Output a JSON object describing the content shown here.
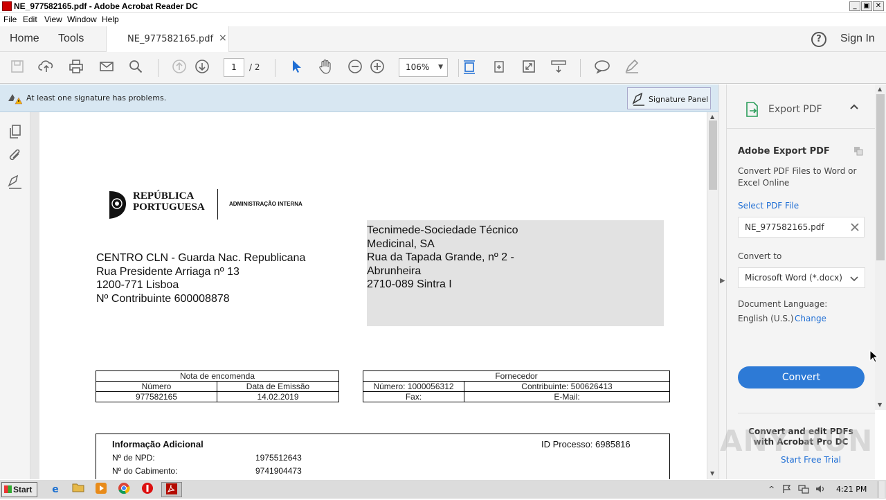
{
  "window": {
    "title": "NE_977582165.pdf - Adobe Acrobat Reader DC",
    "controls": [
      "_",
      "▣",
      "✕"
    ]
  },
  "menu": [
    "File",
    "Edit",
    "View",
    "Window",
    "Help"
  ],
  "tabs": {
    "home": "Home",
    "tools": "Tools",
    "doc": "NE_977582165.pdf",
    "doc_close": "×",
    "sign_in": "Sign In",
    "help": "?"
  },
  "toolbar": {
    "page_current": "1",
    "page_total": "/ 2",
    "zoom": "106%",
    "zoom_caret": "▼"
  },
  "sigbar": {
    "message": "At least one signature has problems.",
    "panel_button": "Signature Panel"
  },
  "doc": {
    "logo_line1": "REPÚBLICA",
    "logo_line2": "PORTUGUESA",
    "logo_dept": "ADMINISTRAÇÃO INTERNA",
    "sender": [
      "CENTRO CLN - Guarda Nac. Republicana",
      "Rua Presidente Arriaga nº 13",
      "1200-771 Lisboa",
      "Nº Contribuinte 600008878"
    ],
    "recipient": [
      "Tecnimede-Sociedade Técnico",
      "Medicinal, SA",
      "Rua da Tapada Grande, nº 2 -",
      "Abrunheira",
      "2710-089 Sintra I"
    ],
    "order_table": {
      "title": "Nota de encomenda",
      "h1": "Número",
      "h2": "Data de Emissão",
      "v1": "977582165",
      "v2": "14.02.2019"
    },
    "supplier_table": {
      "title": "Fornecedor",
      "c1": "Número: 1000056312",
      "c2": "Contribuinte: 500626413",
      "c3": "Fax:",
      "c4": "E-Mail:"
    },
    "info": {
      "title": "Informação Adicional",
      "process": "ID Processo: 6985816",
      "npd_label": "Nº de NPD:",
      "npd_value": "1975512643",
      "cab_label": "Nº do Cabimento:",
      "cab_value": "9741904473"
    }
  },
  "panel": {
    "header": "Export PDF",
    "section_title": "Adobe Export PDF",
    "desc": "Convert PDF Files to Word or Excel Online",
    "select_link": "Select PDF File",
    "file_name": "NE_977582165.pdf",
    "convert_to_label": "Convert to",
    "format": "Microsoft Word (*.docx)",
    "lang_label": "Document Language:",
    "lang_value": "English (U.S.)",
    "lang_change": "Change",
    "convert_button": "Convert",
    "promo_line1": "Convert and edit PDFs",
    "promo_line2": "with Acrobat Pro DC",
    "promo_link": "Start Free Trial"
  },
  "taskbar": {
    "start": "Start",
    "clock": "4:21 PM"
  },
  "watermark": "ANY RUN"
}
